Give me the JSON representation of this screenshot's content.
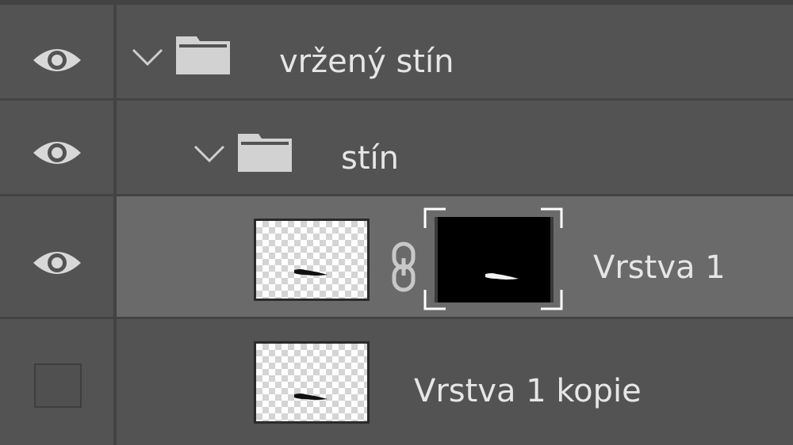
{
  "layers": [
    {
      "type": "group",
      "name": "vržený stín",
      "visible": true,
      "expanded": true,
      "selected": false
    },
    {
      "type": "group",
      "name": "stín",
      "visible": true,
      "expanded": true,
      "selected": false
    },
    {
      "type": "layer",
      "name": "Vrstva 1",
      "visible": true,
      "has_mask": true,
      "linked": true,
      "selected": true
    },
    {
      "type": "layer",
      "name": "Vrstva 1 kopie",
      "visible": false,
      "has_mask": false,
      "selected": false
    }
  ],
  "icons": {
    "visibility": "eye-icon",
    "group": "folder-icon",
    "expand": "chevron-down-icon",
    "mask_link": "chain-link-icon"
  },
  "colors": {
    "panel_bg": "#535353",
    "selected_bg": "#6a6a6a",
    "separator": "#434343",
    "text": "#e6e6e6"
  }
}
